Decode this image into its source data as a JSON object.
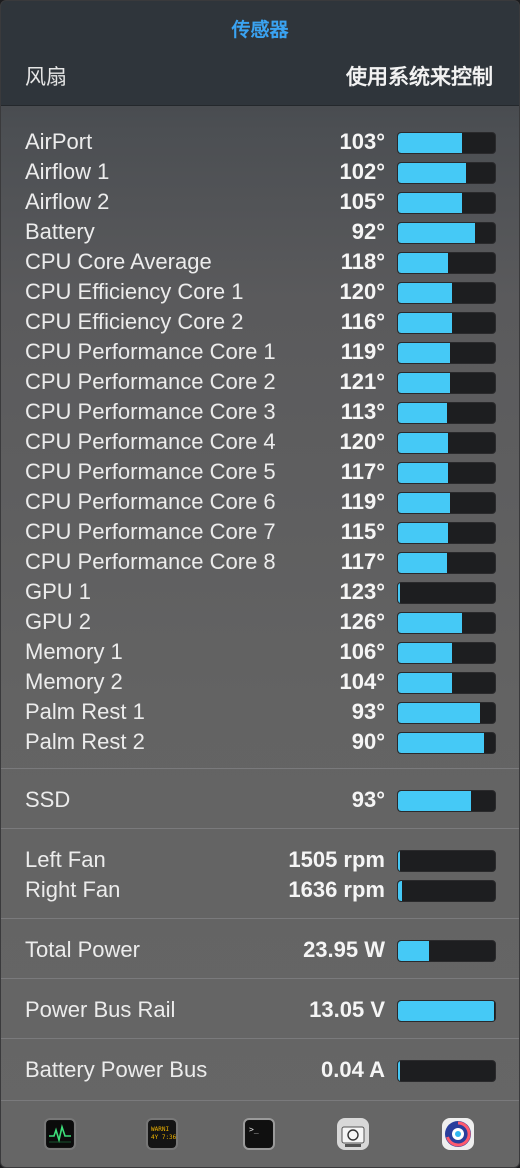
{
  "header": {
    "title": "传感器",
    "fan_label": "风扇",
    "fan_mode": "使用系统来控制"
  },
  "colors": {
    "accent": "#3aa3f2",
    "bar_fill": "#45c9f6",
    "bar_track": "#1d1e20"
  },
  "sections": [
    {
      "rows": [
        {
          "name": "AirPort",
          "value": "103°",
          "level": 0.66
        },
        {
          "name": "Airflow 1",
          "value": "102°",
          "level": 0.7
        },
        {
          "name": "Airflow 2",
          "value": "105°",
          "level": 0.66
        },
        {
          "name": "Battery",
          "value": "92°",
          "level": 0.79
        },
        {
          "name": "CPU Core Average",
          "value": "118°",
          "level": 0.52
        },
        {
          "name": "CPU Efficiency Core 1",
          "value": "120°",
          "level": 0.56
        },
        {
          "name": "CPU Efficiency Core 2",
          "value": "116°",
          "level": 0.56
        },
        {
          "name": "CPU Performance Core 1",
          "value": "119°",
          "level": 0.54
        },
        {
          "name": "CPU Performance Core 2",
          "value": "121°",
          "level": 0.54
        },
        {
          "name": "CPU Performance Core 3",
          "value": "113°",
          "level": 0.5
        },
        {
          "name": "CPU Performance Core 4",
          "value": "120°",
          "level": 0.52
        },
        {
          "name": "CPU Performance Core 5",
          "value": "117°",
          "level": 0.52
        },
        {
          "name": "CPU Performance Core 6",
          "value": "119°",
          "level": 0.54
        },
        {
          "name": "CPU Performance Core 7",
          "value": "115°",
          "level": 0.52
        },
        {
          "name": "CPU Performance Core 8",
          "value": "117°",
          "level": 0.5
        },
        {
          "name": "GPU 1",
          "value": "123°",
          "level": 0.02
        },
        {
          "name": "GPU 2",
          "value": "126°",
          "level": 0.66
        },
        {
          "name": "Memory 1",
          "value": "106°",
          "level": 0.56
        },
        {
          "name": "Memory 2",
          "value": "104°",
          "level": 0.56
        },
        {
          "name": "Palm Rest 1",
          "value": "93°",
          "level": 0.85
        },
        {
          "name": "Palm Rest 2",
          "value": "90°",
          "level": 0.89
        }
      ]
    },
    {
      "rows": [
        {
          "name": "SSD",
          "value": "93°",
          "level": 0.75
        }
      ]
    },
    {
      "rows": [
        {
          "name": "Left Fan",
          "value": "1505 rpm",
          "level": 0.02
        },
        {
          "name": "Right Fan",
          "value": "1636 rpm",
          "level": 0.04
        }
      ]
    },
    {
      "rows": [
        {
          "name": "Total Power",
          "value": "23.95 W",
          "level": 0.32
        }
      ]
    },
    {
      "rows": [
        {
          "name": "Power Bus Rail",
          "value": "13.05 V",
          "level": 0.99
        }
      ]
    },
    {
      "rows": [
        {
          "name": "Battery Power Bus",
          "value": "0.04 A",
          "level": 0.02
        }
      ]
    }
  ],
  "dock": [
    {
      "icon": "activity-monitor-icon"
    },
    {
      "icon": "console-icon",
      "text": "WARNI\n4Y 7:36"
    },
    {
      "icon": "terminal-icon",
      "text": ">_"
    },
    {
      "icon": "system-information-icon"
    },
    {
      "icon": "tg-pro-icon"
    }
  ]
}
